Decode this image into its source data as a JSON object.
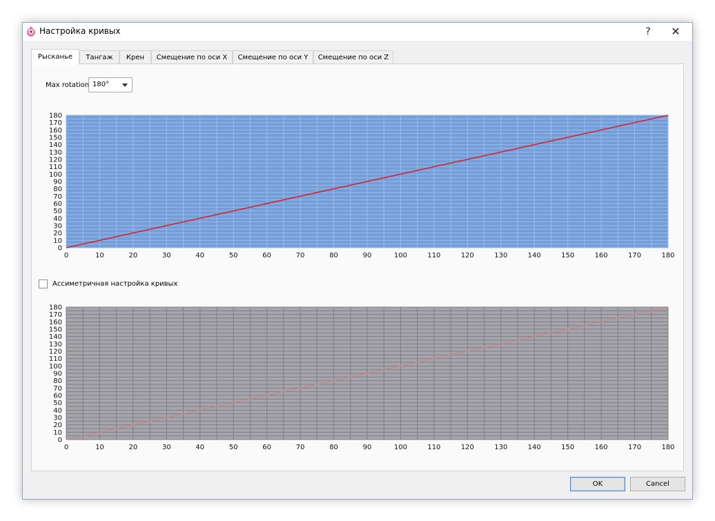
{
  "window": {
    "title": "Настройка кривых",
    "help_label": "?",
    "close_label": "✕"
  },
  "tabs": [
    {
      "label": "Рысканье",
      "active": true
    },
    {
      "label": "Тангаж",
      "active": false
    },
    {
      "label": "Крен",
      "active": false
    },
    {
      "label": "Смещение по оси X",
      "active": false
    },
    {
      "label": "Смещение по оси Y",
      "active": false
    },
    {
      "label": "Смещение по оси Z",
      "active": false
    }
  ],
  "max_rotation": {
    "label": "Max rotation",
    "value": "180°"
  },
  "asymmetric": {
    "label": "Ассиметричная настройка кривых",
    "checked": false
  },
  "buttons": {
    "ok": "OK",
    "cancel": "Cancel"
  },
  "colors": {
    "top_plot_bg": "#739ed9",
    "top_grid": "#9cbce6",
    "top_curve": "#d6212b",
    "bottom_plot_bg": "#a6a5ab",
    "bottom_grid": "#7e7d83",
    "bottom_curve": "#c38a8c"
  },
  "chart_data": [
    {
      "type": "line",
      "x": [
        0,
        180
      ],
      "y": [
        0,
        180
      ],
      "xlim": [
        0,
        180
      ],
      "ylim": [
        0,
        180
      ],
      "x_ticks": [
        0,
        10,
        20,
        30,
        40,
        50,
        60,
        70,
        80,
        90,
        100,
        110,
        120,
        130,
        140,
        150,
        160,
        170,
        180
      ],
      "y_ticks": [
        0,
        10,
        20,
        30,
        40,
        50,
        60,
        70,
        80,
        90,
        100,
        110,
        120,
        130,
        140,
        150,
        160,
        170,
        180
      ],
      "grid": true,
      "enabled": true
    },
    {
      "type": "line",
      "x": [
        0,
        180
      ],
      "y": [
        0,
        180
      ],
      "xlim": [
        0,
        180
      ],
      "ylim": [
        0,
        180
      ],
      "x_ticks": [
        0,
        10,
        20,
        30,
        40,
        50,
        60,
        70,
        80,
        90,
        100,
        110,
        120,
        130,
        140,
        150,
        160,
        170,
        180
      ],
      "y_ticks": [
        0,
        10,
        20,
        30,
        40,
        50,
        60,
        70,
        80,
        90,
        100,
        110,
        120,
        130,
        140,
        150,
        160,
        170,
        180
      ],
      "grid": true,
      "enabled": false
    }
  ]
}
